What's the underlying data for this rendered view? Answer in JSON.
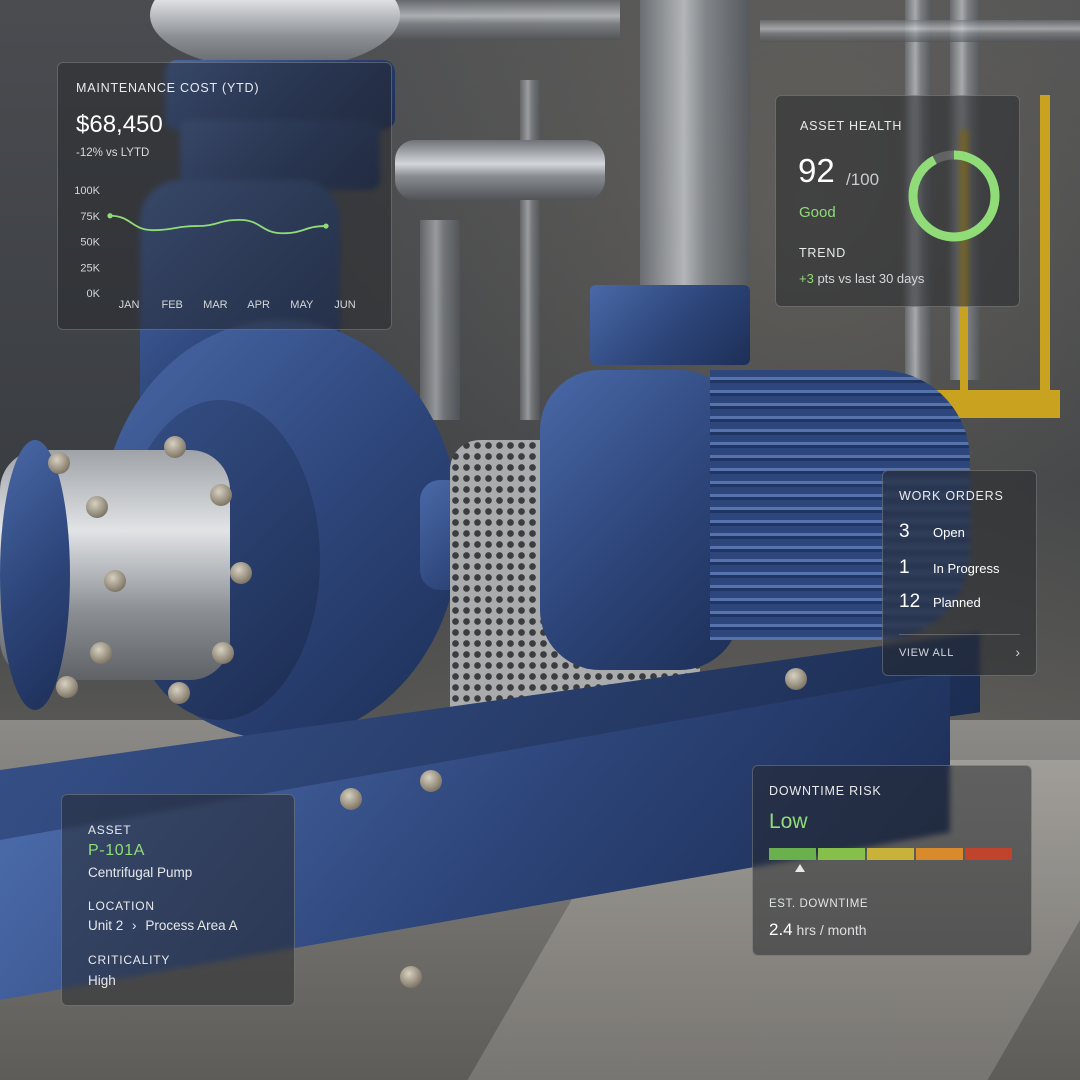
{
  "maintenance": {
    "title": "MAINTENANCE COST (YTD)",
    "value": "$68,450",
    "delta": "-12% vs LYTD",
    "accent_color": "#8fdc78"
  },
  "chart_data": {
    "type": "line",
    "title": "MAINTENANCE COST (YTD)",
    "categories": [
      "JAN",
      "FEB",
      "MAR",
      "APR",
      "MAY",
      "JUN"
    ],
    "series": [
      {
        "values": [
          75000,
          61000,
          65000,
          71000,
          58000,
          65000
        ]
      }
    ],
    "y_ticks": [
      "100K",
      "75K",
      "50K",
      "25K",
      "0K"
    ],
    "ylim": [
      0,
      100000
    ],
    "grid": false
  },
  "health": {
    "title": "ASSET HEALTH",
    "score": "92",
    "out_of": "/100",
    "score_value": 92,
    "status": "Good",
    "trend_label": "TREND",
    "trend_delta": "+3",
    "trend_text": "pts vs last 30 days",
    "ring_color": "#8fdc78"
  },
  "work_orders": {
    "title": "WORK ORDERS",
    "rows": [
      {
        "count": "3",
        "label": "Open"
      },
      {
        "count": "1",
        "label": "In Progress"
      },
      {
        "count": "12",
        "label": "Planned"
      }
    ],
    "view_all": "VIEW ALL",
    "chevron": "›"
  },
  "asset": {
    "asset_label": "ASSET",
    "asset_id": "P-101A",
    "asset_type": "Centrifugal Pump",
    "location_label": "LOCATION",
    "location_unit": "Unit 2",
    "location_sep": "›",
    "location_area": "Process Area A",
    "criticality_label": "CRITICALITY",
    "criticality": "High"
  },
  "downtime": {
    "title": "DOWNTIME RISK",
    "level": "Low",
    "scale_colors": [
      "#6ab04c",
      "#86c04a",
      "#c9b23a",
      "#d98a2b",
      "#c0442c"
    ],
    "risk_position_fraction": 0.1,
    "est_label": "EST. DOWNTIME",
    "est_value": "2.4",
    "est_unit": "hrs / month"
  }
}
